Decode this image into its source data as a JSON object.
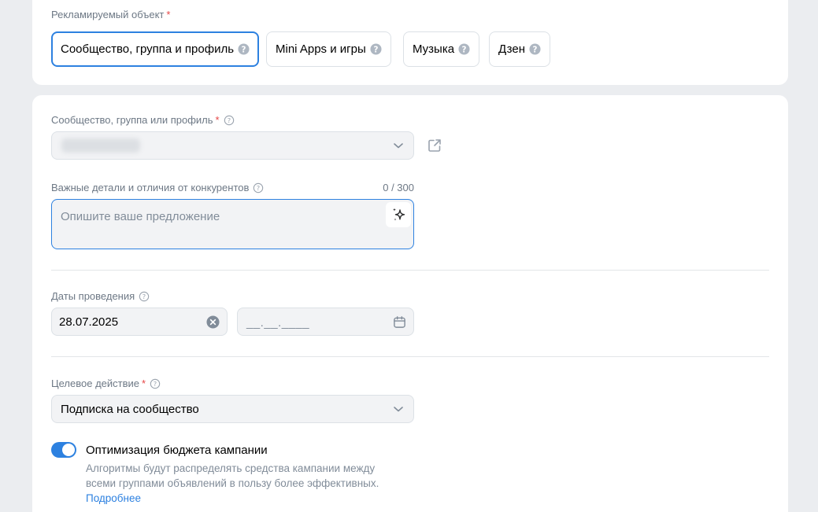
{
  "promoted_object": {
    "label": "Рекламируемый объект",
    "required_mark": "*",
    "options": [
      {
        "label": "Сообщество, группа и профиль",
        "selected": true
      },
      {
        "label": "Mini Apps и игры",
        "selected": false
      },
      {
        "label": "Музыка",
        "selected": false
      },
      {
        "label": "Дзен",
        "selected": false
      }
    ]
  },
  "community": {
    "label": "Сообщество, группа или профиль",
    "required_mark": "*"
  },
  "details": {
    "label": "Важные детали и отличия от конкурентов",
    "counter": "0 / 300",
    "placeholder": "Опишите ваше предложение"
  },
  "dates": {
    "label": "Даты проведения",
    "start": "28.07.2025",
    "end_mask": "__.__.____"
  },
  "target_action": {
    "label": "Целевое действие",
    "required_mark": "*",
    "value": "Подписка на сообщество"
  },
  "budget_optimization": {
    "title": "Оптимизация бюджета кампании",
    "enabled": true,
    "description": "Алгоритмы будут распределять средства кампании между всеми группами объявлений в пользу более эффективных.",
    "link": "Подробнее"
  },
  "colors": {
    "accent": "#2d81e0",
    "required": "#e64646",
    "field_bg": "#f2f3f5",
    "page_bg": "#ebedf0"
  }
}
